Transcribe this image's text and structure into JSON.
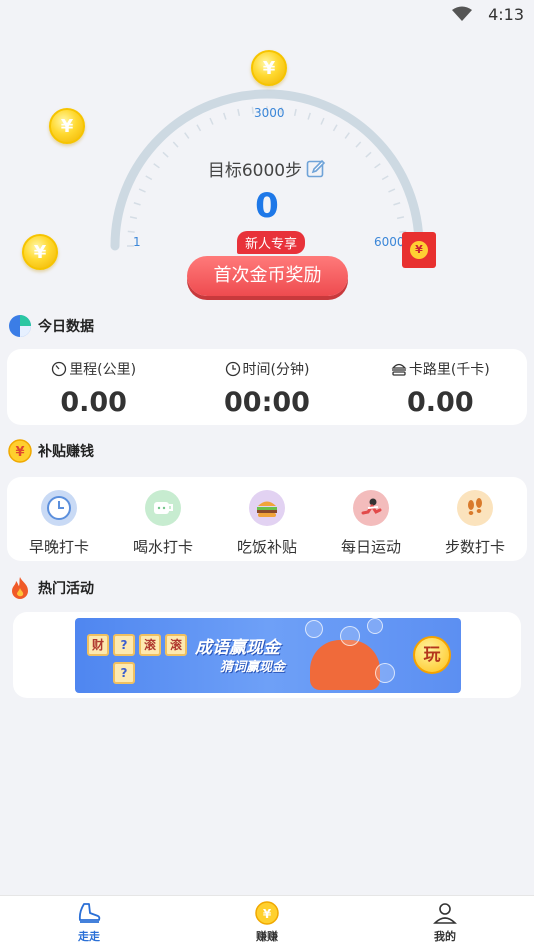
{
  "status_bar": {
    "time": "4:13"
  },
  "gauge": {
    "goal_label": "目标6000步",
    "steps": "0",
    "tick_min": "1",
    "tick_mid": "3000",
    "tick_max": "6000",
    "newbie_tag": "新人专享",
    "reward_button": "首次金币奖励"
  },
  "coin_symbol": "¥",
  "today": {
    "title": "今日数据",
    "stats": [
      {
        "label": "里程(公里)",
        "value": "0.00",
        "icon": "speedometer-icon"
      },
      {
        "label": "时间(分钟)",
        "value": "00:00",
        "icon": "clock-icon"
      },
      {
        "label": "卡路里(千卡)",
        "value": "0.00",
        "icon": "burger-outline-icon"
      }
    ]
  },
  "subsidy": {
    "title": "补贴赚钱",
    "items": [
      {
        "label": "早晚打卡",
        "icon": "clock-icon"
      },
      {
        "label": "喝水打卡",
        "icon": "cup-icon"
      },
      {
        "label": "吃饭补贴",
        "icon": "burger-icon"
      },
      {
        "label": "每日运动",
        "icon": "exercise-icon"
      },
      {
        "label": "步数打卡",
        "icon": "footprints-icon"
      }
    ]
  },
  "hot": {
    "title": "热门活动",
    "banner": {
      "title": "成语赢现金",
      "subtitle": "猜词赢现金",
      "play": "玩",
      "tiles": [
        "财",
        "?",
        "滚",
        "滚",
        "?"
      ]
    }
  },
  "tabbar": [
    {
      "label": "走走",
      "icon": "shoe-icon",
      "active": true
    },
    {
      "label": "赚赚",
      "icon": "coin-icon",
      "active": false
    },
    {
      "label": "我的",
      "icon": "user-icon",
      "active": false
    }
  ]
}
